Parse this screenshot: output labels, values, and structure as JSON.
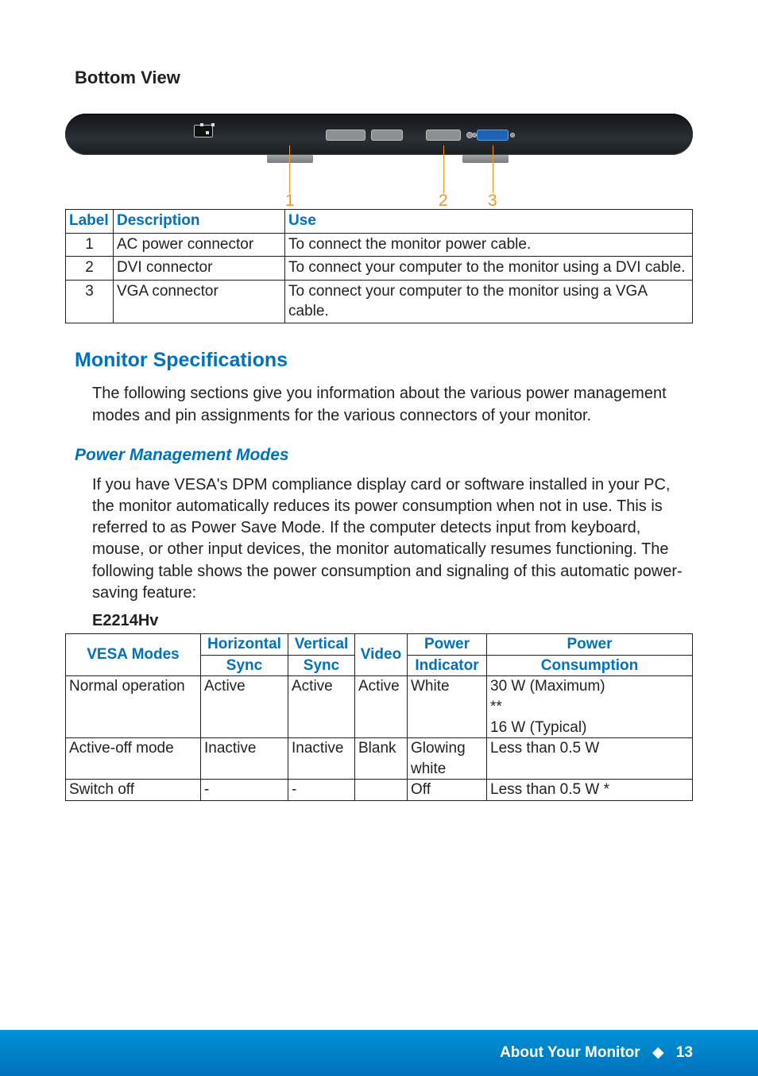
{
  "headings": {
    "bottom_view": "Bottom View",
    "monitor_spec": "Monitor Specifications",
    "pm_modes": "Power Management Modes",
    "model": "E2214Hv"
  },
  "diagram_labels": {
    "n1": "1",
    "n2": "2",
    "n3": "3"
  },
  "bottom_table": {
    "headers": {
      "label": "Label",
      "desc": "Description",
      "use": "Use"
    },
    "rows": [
      {
        "label": "1",
        "desc": "AC power connector",
        "use": "To connect the monitor power cable."
      },
      {
        "label": "2",
        "desc": "DVI connector",
        "use": "To connect your computer to the monitor using a DVI cable."
      },
      {
        "label": "3",
        "desc": "VGA connector",
        "use": "To connect your computer to the monitor using a VGA cable."
      }
    ]
  },
  "paragraphs": {
    "spec_intro": "The following sections give you information about the various power management modes and pin assignments for the various connectors of your monitor.",
    "pm_intro": "If you have VESA's DPM compliance display card or software installed in your PC, the monitor automatically reduces its power consumption when not in use. This is referred to as Power Save Mode. If the computer detects input from keyboard, mouse, or other input devices, the monitor automatically resumes functioning. The following table shows the power consumption and signaling of this automatic power-saving feature:"
  },
  "pm_table": {
    "headers": {
      "vesa": "VESA Modes",
      "hsync_top": "Horizontal",
      "hsync_bot": "Sync",
      "vsync_top": "Vertical",
      "vsync_bot": "Sync",
      "video": "Video",
      "pi_top": "Power",
      "pi_bot": "Indicator",
      "pc_top": "Power",
      "pc_bot": "Consumption"
    },
    "rows": [
      {
        "vesa": "Normal operation",
        "h": "Active",
        "v": "Active",
        "video": "Active",
        "pi": "White",
        "pc": "30 W (Maximum)\n**\n16 W (Typical)"
      },
      {
        "vesa": "Active-off mode",
        "h": "Inactive",
        "v": "Inactive",
        "video": "Blank",
        "pi": "Glowing\nwhite",
        "pc": "Less than 0.5 W"
      },
      {
        "vesa": "Switch off",
        "h": "-",
        "v": "-",
        "video": "",
        "pi": "Off",
        "pc": "Less than 0.5 W *"
      }
    ]
  },
  "footer": {
    "section": "About Your Monitor",
    "sep": "◆",
    "page": "13"
  }
}
